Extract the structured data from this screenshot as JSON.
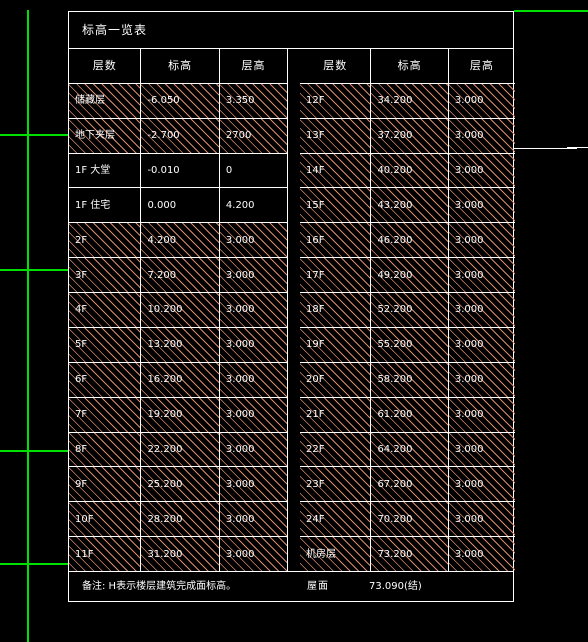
{
  "drawing": {
    "title": "标高一览表",
    "background_color": "#000000",
    "line_color": "#ffffff",
    "hatch_color": "#d98a6e",
    "grid_color": "#00e000"
  },
  "headers": [
    "层数",
    "标高",
    "层高"
  ],
  "table_left": {
    "headers": [
      "层数",
      "标高",
      "层高"
    ],
    "rows": [
      {
        "floor": "储藏层",
        "elevation": "-6.050",
        "height": "3.350",
        "hatched": true
      },
      {
        "floor": "地下夹层",
        "elevation": "-2.700",
        "height": "2700",
        "hatched": true
      },
      {
        "floor": "1F 大堂",
        "elevation": "-0.010",
        "height": "0",
        "hatched": false
      },
      {
        "floor": "1F 住宅",
        "elevation": "0.000",
        "height": "4.200",
        "hatched": false
      },
      {
        "floor": "2F",
        "elevation": "4.200",
        "height": "3.000",
        "hatched": true
      },
      {
        "floor": "3F",
        "elevation": "7.200",
        "height": "3.000",
        "hatched": true
      },
      {
        "floor": "4F",
        "elevation": "10.200",
        "height": "3.000",
        "hatched": true
      },
      {
        "floor": "5F",
        "elevation": "13.200",
        "height": "3.000",
        "hatched": true
      },
      {
        "floor": "6F",
        "elevation": "16.200",
        "height": "3.000",
        "hatched": true
      },
      {
        "floor": "7F",
        "elevation": "19.200",
        "height": "3.000",
        "hatched": true
      },
      {
        "floor": "8F",
        "elevation": "22.200",
        "height": "3.000",
        "hatched": true
      },
      {
        "floor": "9F",
        "elevation": "25.200",
        "height": "3.000",
        "hatched": true
      },
      {
        "floor": "10F",
        "elevation": "28.200",
        "height": "3.000",
        "hatched": true
      },
      {
        "floor": "11F",
        "elevation": "31.200",
        "height": "3.000",
        "hatched": true
      }
    ]
  },
  "table_right": {
    "headers": [
      "层数",
      "标高",
      "层高"
    ],
    "rows": [
      {
        "floor": "12F",
        "elevation": "34.200",
        "height": "3.000",
        "hatched": true
      },
      {
        "floor": "13F",
        "elevation": "37.200",
        "height": "3.000",
        "hatched": true
      },
      {
        "floor": "14F",
        "elevation": "40.200",
        "height": "3.000",
        "hatched": true
      },
      {
        "floor": "15F",
        "elevation": "43.200",
        "height": "3.000",
        "hatched": true
      },
      {
        "floor": "16F",
        "elevation": "46.200",
        "height": "3.000",
        "hatched": true
      },
      {
        "floor": "17F",
        "elevation": "49.200",
        "height": "3.000",
        "hatched": true
      },
      {
        "floor": "18F",
        "elevation": "52.200",
        "height": "3.000",
        "hatched": true
      },
      {
        "floor": "19F",
        "elevation": "55.200",
        "height": "3.000",
        "hatched": true
      },
      {
        "floor": "20F",
        "elevation": "58.200",
        "height": "3.000",
        "hatched": true
      },
      {
        "floor": "21F",
        "elevation": "61.200",
        "height": "3.000",
        "hatched": true
      },
      {
        "floor": "22F",
        "elevation": "64.200",
        "height": "3.000",
        "hatched": true
      },
      {
        "floor": "23F",
        "elevation": "67.200",
        "height": "3.000",
        "hatched": true
      },
      {
        "floor": "24F",
        "elevation": "70.200",
        "height": "3.000",
        "hatched": true
      },
      {
        "floor": "机房层",
        "elevation": "73.200",
        "height": "3.000",
        "hatched": true
      }
    ]
  },
  "note": {
    "text": "备注: H表示楼层建筑完成面标高。",
    "roof_label": "屋面",
    "roof_value": "73.090(结)"
  }
}
